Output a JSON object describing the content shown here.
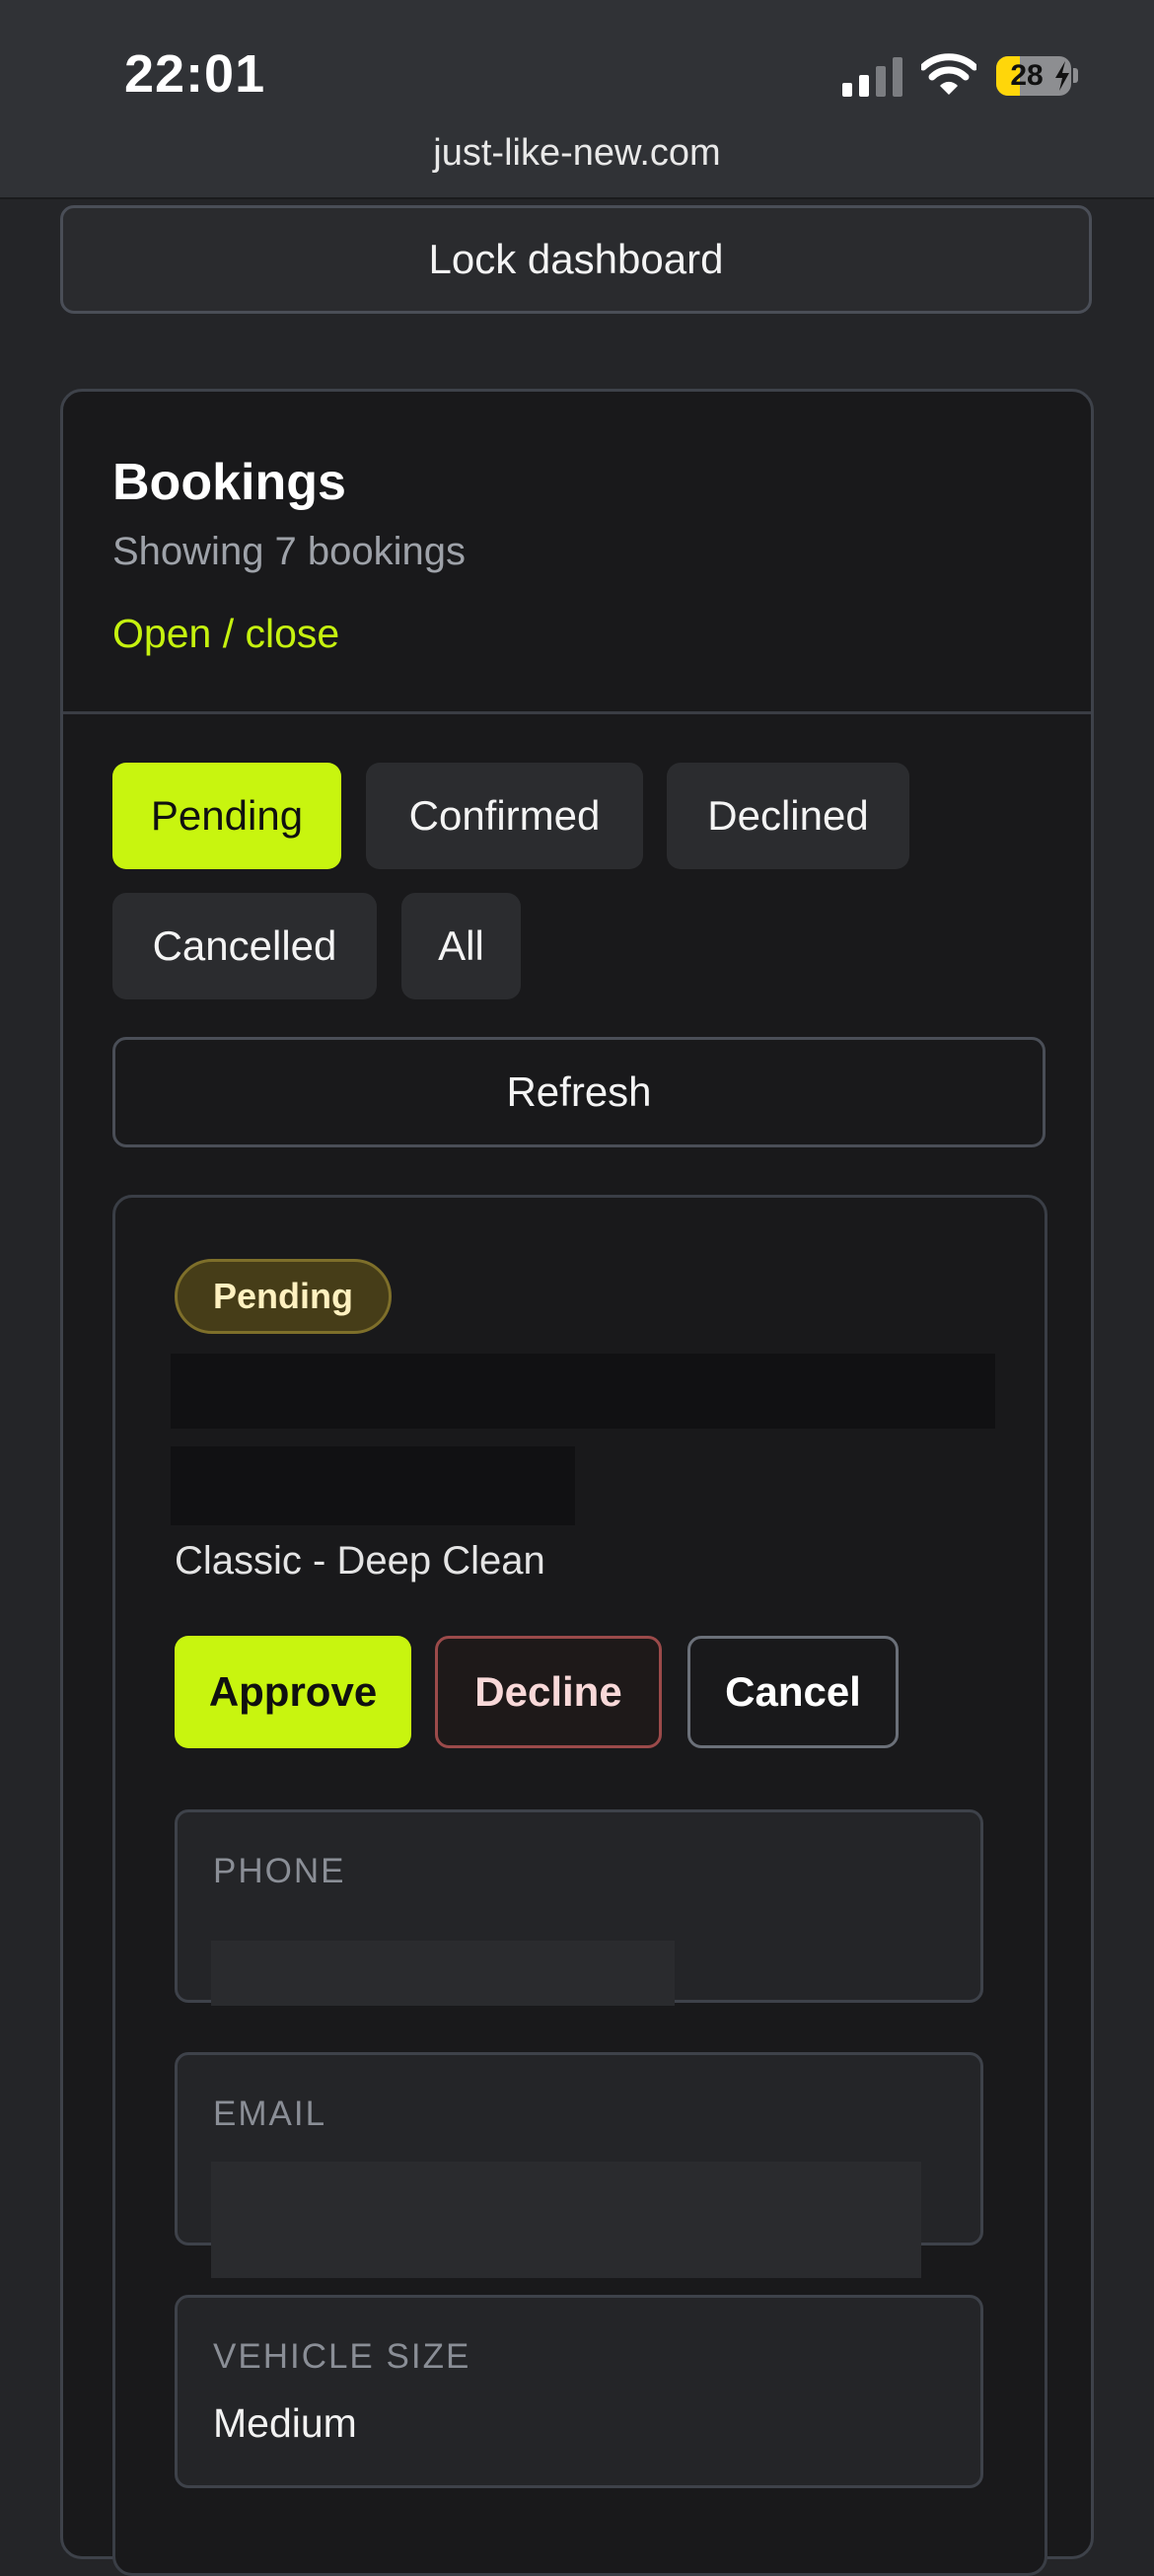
{
  "status_bar": {
    "time": "22:01",
    "battery": "28",
    "url": "just-like-new.com"
  },
  "lock_label": "Lock dashboard",
  "bookings": {
    "title": "Bookings",
    "subtitle": "Showing 7 bookings",
    "toggle_label": "Open / close",
    "filters": [
      "Pending",
      "Confirmed",
      "Declined",
      "Cancelled",
      "All"
    ],
    "active_filter": "Pending",
    "refresh_label": "Refresh"
  },
  "booking_card": {
    "status": "Pending",
    "service": "Classic - Deep Clean",
    "actions": {
      "approve": "Approve",
      "decline": "Decline",
      "cancel": "Cancel"
    },
    "fields": {
      "phone_label": "PHONE",
      "email_label": "EMAIL",
      "vehicle_size_label": "VEHICLE SIZE",
      "vehicle_size_value": "Medium"
    }
  },
  "colors": {
    "accent": "#c8f50f",
    "background": "#242528",
    "panel": "#19191b",
    "pending_badge": "#463d18",
    "decline_border": "#9b4a4a"
  },
  "icons": [
    "signal-icon",
    "wifi-icon",
    "battery-icon"
  ]
}
